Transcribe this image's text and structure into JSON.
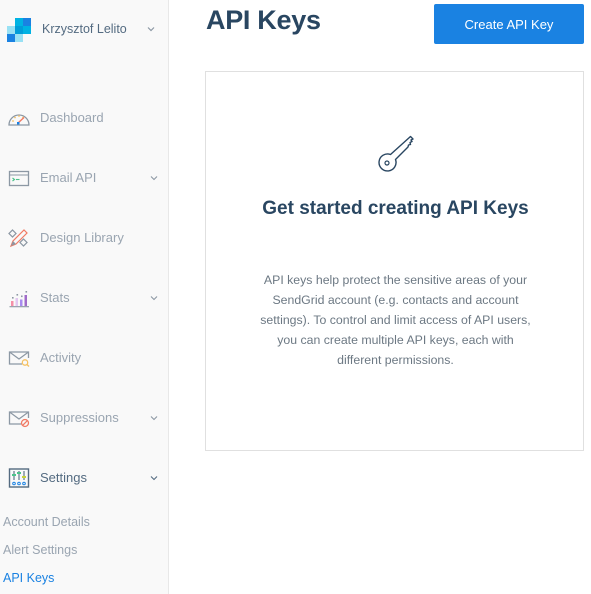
{
  "account": {
    "name": "Krzysztof Lelito",
    "logo_colors": [
      "#00b3e3",
      "#1a82e2",
      "#99e1f4",
      "#009dd9",
      "#00b2e3",
      "#1a82e2",
      "#99e1f4"
    ]
  },
  "sidebar": {
    "items": [
      {
        "label": "Dashboard",
        "icon": "dashboard-gauge-icon",
        "has_chevron": false
      },
      {
        "label": "Email API",
        "icon": "terminal-window-icon",
        "has_chevron": true
      },
      {
        "label": "Design Library",
        "icon": "pencil-ruler-icon",
        "has_chevron": false
      },
      {
        "label": "Stats",
        "icon": "bar-chart-icon",
        "has_chevron": true
      },
      {
        "label": "Activity",
        "icon": "envelope-search-icon",
        "has_chevron": false
      },
      {
        "label": "Suppressions",
        "icon": "envelope-blocked-icon",
        "has_chevron": true
      },
      {
        "label": "Settings",
        "icon": "sliders-icon",
        "has_chevron": true,
        "expanded": true
      }
    ],
    "settings_subitems": [
      {
        "label": "Account Details",
        "active": false
      },
      {
        "label": "Alert Settings",
        "active": false
      },
      {
        "label": "API Keys",
        "active": true
      }
    ]
  },
  "header": {
    "title": "API Keys",
    "create_button_label": "Create API Key"
  },
  "empty_state": {
    "icon": "key-icon",
    "title": "Get started creating API Keys",
    "description": "API keys help protect the sensitive areas of your SendGrid account (e.g. contacts and account settings). To control and limit access of API users, you can create multiple API keys, each with different permissions."
  },
  "colors": {
    "primary": "#1a82e2",
    "heading": "#294661",
    "muted": "#9aa5b1",
    "body_text": "#6c7883"
  }
}
